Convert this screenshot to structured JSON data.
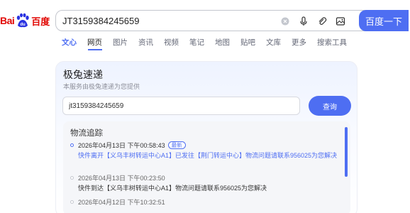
{
  "logo": {
    "text_left": "Bai",
    "text_du": "du",
    "text_right": "百度"
  },
  "search": {
    "value": "JT3159384245659",
    "button_label": "百度一下"
  },
  "tabs": [
    "文心",
    "网页",
    "图片",
    "资讯",
    "视频",
    "笔记",
    "地图",
    "贴吧",
    "文库",
    "更多",
    "搜索工具"
  ],
  "card": {
    "title": "极兔速递",
    "subtitle": "本服务由极兔速递为您提供",
    "tracking_input_value": "jt3159384245659",
    "query_button": "查询"
  },
  "logistics": {
    "title": "物流追踪",
    "entries": [
      {
        "time": "2026年04月13日 下午00:58:43",
        "badge": "最新",
        "desc": "快件离开【义乌丰树转运中心A1】已发往【荆门转运中心】物流问题请联系956025为您解决"
      },
      {
        "time": "2026年04月13日 下午00:23:50",
        "desc": "快件到达【义乌丰树转运中心A1】物流问题请联系956025为您解决"
      },
      {
        "time": "2026年04月12日 下午10:32:51"
      }
    ]
  },
  "colors": {
    "accent": "#4e6ef2",
    "brand_red": "#e10602"
  }
}
